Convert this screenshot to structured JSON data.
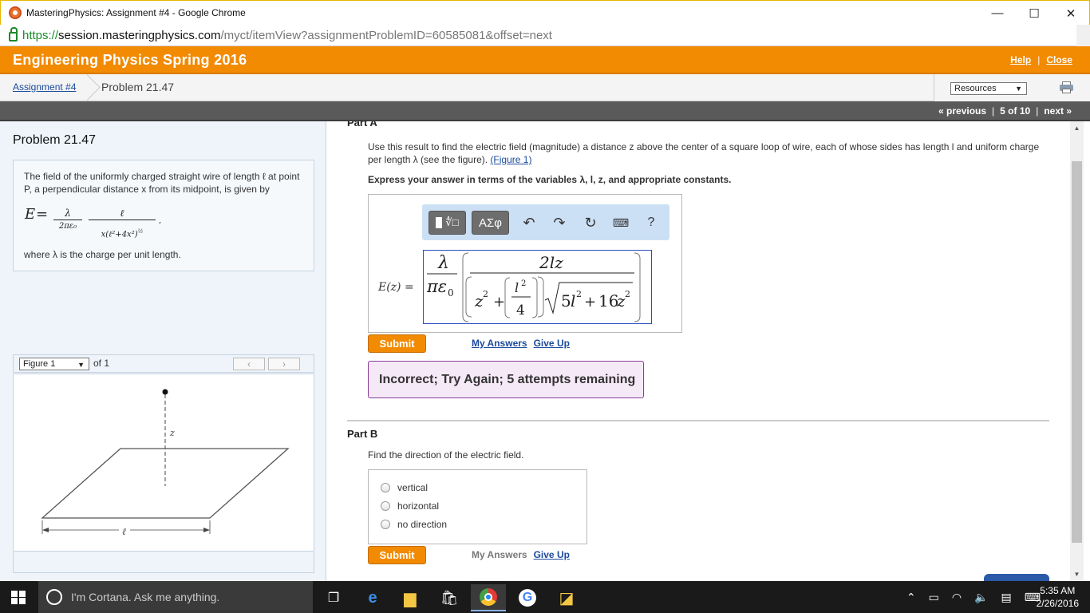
{
  "window": {
    "title": "MasteringPhysics: Assignment #4 - Google Chrome",
    "minimize": "—",
    "maximize": "☐",
    "close": "✕"
  },
  "address": {
    "scheme": "https://",
    "host": "session.masteringphysics.com",
    "path": "/myct/itemView?assignmentProblemID=60585081&offset=next"
  },
  "header": {
    "course": "Engineering Physics Spring 2016",
    "help": "Help",
    "close": "Close"
  },
  "breadcrumb": {
    "assignment": "Assignment #4",
    "problem": "Problem 21.47",
    "resources": "Resources"
  },
  "nav": {
    "previous": "« previous",
    "position": "5 of 10",
    "next": "next »"
  },
  "problem": {
    "title": "Problem 21.47",
    "intro": "The field of the uniformly charged straight wire of length ℓ at point P, a perpendicular distance x from its midpoint, is given by",
    "where": "where λ is the charge per unit length."
  },
  "figure": {
    "selected": "Figure 1",
    "of": "of 1",
    "prev": "‹",
    "next": "›",
    "z_label": "z",
    "l_label": "ℓ"
  },
  "partA": {
    "header": "Part A",
    "question_main": "Use this result to find the electric field (magnitude) a distance z above the center of a square loop of wire, each of whose sides has length l and uniform charge per length λ (see the figure).",
    "figure_link": "(Figure 1)",
    "express": "Express your answer in terms of the variables λ, l, z, and appropriate constants.",
    "toolbar_greek": "ΑΣφ",
    "toolbar_help": "?",
    "eq_label": "E(z) =",
    "submit": "Submit",
    "my_answers": "My Answers",
    "give_up": "Give Up",
    "feedback": "Incorrect; Try Again; 5 attempts remaining"
  },
  "partB": {
    "header": "Part B",
    "question": "Find the direction of the electric field.",
    "options": [
      "vertical",
      "horizontal",
      "no direction"
    ],
    "submit": "Submit",
    "my_answers": "My Answers",
    "give_up": "Give Up"
  },
  "taskbar": {
    "cortana": "I'm Cortana. Ask me anything.",
    "time": "5:35 AM",
    "date": "2/26/2016"
  },
  "colors": {
    "brand_orange": "#f28a02",
    "link_blue": "#1a4a9c",
    "feedback_border": "#8a3a98"
  }
}
